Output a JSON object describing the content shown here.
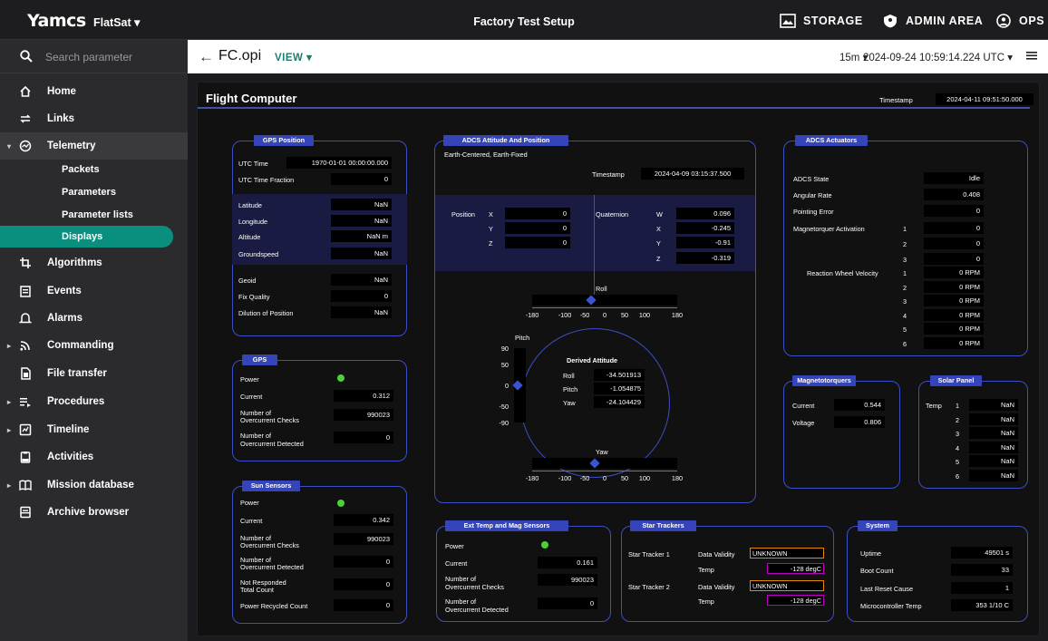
{
  "topbar": {
    "logo": "Yamcs",
    "instance": "FlatSat ▾",
    "title": "Factory Test Setup",
    "storage": "STORAGE",
    "admin": "ADMIN AREA",
    "ops": "OPS"
  },
  "search": {
    "placeholder": "Search parameter"
  },
  "nav": [
    {
      "label": "Home",
      "icon": "home-icon"
    },
    {
      "label": "Links",
      "icon": "links-icon"
    },
    {
      "label": "Telemetry",
      "icon": "telemetry-icon"
    },
    {
      "label": "Algorithms",
      "icon": "algorithms-icon"
    },
    {
      "label": "Events",
      "icon": "events-icon"
    },
    {
      "label": "Alarms",
      "icon": "alarms-icon"
    },
    {
      "label": "Commanding",
      "icon": "commanding-icon"
    },
    {
      "label": "File transfer",
      "icon": "file-transfer-icon"
    },
    {
      "label": "Procedures",
      "icon": "procedures-icon"
    },
    {
      "label": "Timeline",
      "icon": "timeline-icon"
    },
    {
      "label": "Activities",
      "icon": "activities-icon"
    },
    {
      "label": "Mission database",
      "icon": "mission-database-icon"
    },
    {
      "label": "Archive browser",
      "icon": "archive-browser-icon"
    }
  ],
  "telemetry_sub": [
    "Packets",
    "Parameters",
    "Parameter lists",
    "Displays"
  ],
  "crumb": {
    "back": "←",
    "file": "FC.opi",
    "view": "VIEW ▾",
    "range": "15m ▾",
    "time": "2024-09-24 10:59:14.224 UTC ▾"
  },
  "display": {
    "title": "Flight Computer",
    "timestamp_label": "Timestamp",
    "timestamp": "2024-04-11 09:51:50.000",
    "gps_position": {
      "title": "GPS Position",
      "utc_label": "UTC Time",
      "utc": "1970-01-01 00:00:00.000",
      "utcf_label": "UTC Time Fraction",
      "utcf": "0",
      "lat_label": "Latitude",
      "lat": "NaN",
      "lon_label": "Longitude",
      "lon": "NaN",
      "alt_label": "Altitude",
      "alt": "NaN m",
      "gs_label": "Groundspeed",
      "gs": "NaN",
      "geoid_label": "Geoid",
      "geoid": "NaN",
      "fix_label": "Fix Quality",
      "fix": "0",
      "dop_label": "Dilution of Position",
      "dop": "NaN"
    },
    "gps": {
      "title": "GPS",
      "power_label": "Power",
      "current_label": "Current",
      "current": "0.312",
      "occ_label1": "Number of",
      "occ_label2": "Overcurrent Checks",
      "occ": "990023",
      "ocd_label1": "Number of",
      "ocd_label2": "Overcurrent Detected",
      "ocd": "0"
    },
    "sun": {
      "title": "Sun Sensors",
      "power_label": "Power",
      "current_label": "Current",
      "current": "0.342",
      "occ_label1": "Number of",
      "occ_label2": "Overcurrent Checks",
      "occ": "990023",
      "ocd_label1": "Number of",
      "ocd_label2": "Overcurrent Detected",
      "ocd": "0",
      "nr_label1": "Not Responded",
      "nr_label2": "Total Count",
      "nr": "0",
      "prc_label": "Power Recycled Count",
      "prc": "0"
    },
    "adcs": {
      "title": "ADCS Attitude And Position",
      "frame": "Earth-Centered, Earth-Fixed",
      "ts_label": "Timestamp",
      "ts": "2024-04-09 03:15:37.500",
      "pos_label": "Position",
      "px": "0",
      "py": "0",
      "pz": "0",
      "quat_label": "Quaternion",
      "qw": "0.096",
      "qx": "-0.245",
      "qy": "-0.91",
      "qz": "-0.319",
      "x": "X",
      "y": "Y",
      "z": "Z",
      "w": "W",
      "roll_label": "Roll",
      "pitch_label": "Pitch",
      "yaw_label": "Yaw",
      "derived_label": "Derived Attitude",
      "roll": "-34.501913",
      "pitch": "-1.054875",
      "yaw": "-24.104429",
      "hticks": [
        "-180",
        "-100",
        "-50",
        "0",
        "50",
        "100",
        "180"
      ],
      "vticks": [
        "90",
        "50",
        "0",
        "-50",
        "-90"
      ],
      "roll_value": -34.501913,
      "yaw_value": -24.104429,
      "pitch_value": -1.054875
    },
    "actuators": {
      "title": "ADCS Actuators",
      "state_label": "ADCS State",
      "state": "Idle",
      "rate_label": "Angular Rate",
      "rate": "0.408",
      "perr_label": "Pointing Error",
      "perr": "0",
      "mt_label": "Magnetorquer Activation",
      "mt": [
        "0",
        "0",
        "0"
      ],
      "rw_label": "Reaction Wheel Velocity",
      "rw": [
        "0 RPM",
        "0 RPM",
        "0 RPM",
        "0 RPM",
        "0 RPM",
        "0 RPM"
      ],
      "idx": [
        "1",
        "2",
        "3",
        "4",
        "5",
        "6"
      ]
    },
    "magneto": {
      "title": "Magnetotorquers",
      "current_label": "Current",
      "current": "0.544",
      "voltage_label": "Voltage",
      "voltage": "0.806"
    },
    "solar": {
      "title": "Solar Panel",
      "temp_label": "Temp",
      "temps": [
        "NaN",
        "NaN",
        "NaN",
        "NaN",
        "NaN",
        "NaN"
      ]
    },
    "ext": {
      "title": "Ext Temp and Mag Sensors",
      "power_label": "Power",
      "current_label": "Current",
      "current": "0.161",
      "occ_label1": "Number of",
      "occ_label2": "Overcurrent Checks",
      "occ": "990023",
      "ocd_label1": "Number of",
      "ocd_label2": "Overcurrent Detected",
      "ocd": "0"
    },
    "star": {
      "title": "Star Trackers",
      "st1": "Star Tracker 1",
      "st2": "Star Tracker 2",
      "dv_label": "Data Validity",
      "temp_label": "Temp",
      "dv1": "UNKNOWN",
      "t1": "-128 degC",
      "dv2": "UNKNOWN",
      "t2": "-128 degC"
    },
    "system": {
      "title": "System",
      "uptime_label": "Uptime",
      "uptime": "49501 s",
      "boot_label": "Boot Count",
      "boot": "33",
      "reset_label": "Last Reset Cause",
      "reset": "1",
      "mct_label": "Microcontroller Temp",
      "mct": "353 1/10 C"
    }
  },
  "colors": {
    "accent": "#0a8f7f",
    "panel_border": "#3c4ec6",
    "panel_title": "#3544b8",
    "highlight": "#1a1b42",
    "led_on": "#4cd137",
    "warn_orange": "#e68a00",
    "warn_magenta": "#c000c0"
  }
}
